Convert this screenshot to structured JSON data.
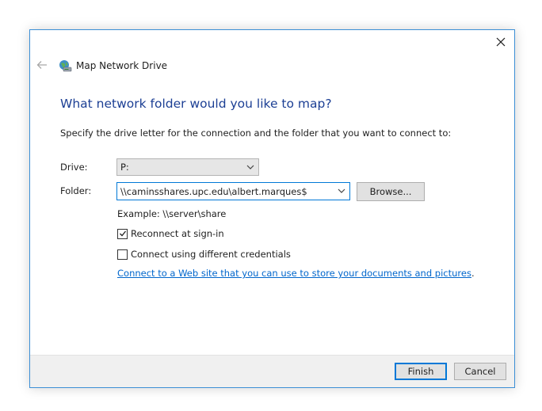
{
  "window": {
    "title": "Map Network Drive",
    "close_glyph": "✕",
    "back_glyph": "←"
  },
  "content": {
    "heading": "What network folder would you like to map?",
    "description": "Specify the drive letter for the connection and the folder that you want to connect to:",
    "drive": {
      "label": "Drive:",
      "value": "P:"
    },
    "folder": {
      "label": "Folder:",
      "value": "\\\\caminsshares.upc.edu\\albert.marques$"
    },
    "browse_label": "Browse...",
    "example": "Example: \\\\server\\share",
    "reconnect": {
      "label": "Reconnect at sign-in",
      "checked": true
    },
    "credentials": {
      "label": "Connect using different credentials",
      "checked": false
    },
    "link_text": "Connect to a Web site that you can use to store your documents and pictures",
    "link_suffix": "."
  },
  "footer": {
    "finish_label": "Finish",
    "cancel_label": "Cancel"
  },
  "colors": {
    "heading": "#1c3f94",
    "link": "#0066cc",
    "focus_border": "#0078d7",
    "window_border": "#3c8fd6"
  },
  "icons": {
    "title": "network-drive-icon",
    "close": "close-icon",
    "back": "back-arrow-icon",
    "dropdown": "chevron-down-icon",
    "check": "checkmark-icon"
  }
}
